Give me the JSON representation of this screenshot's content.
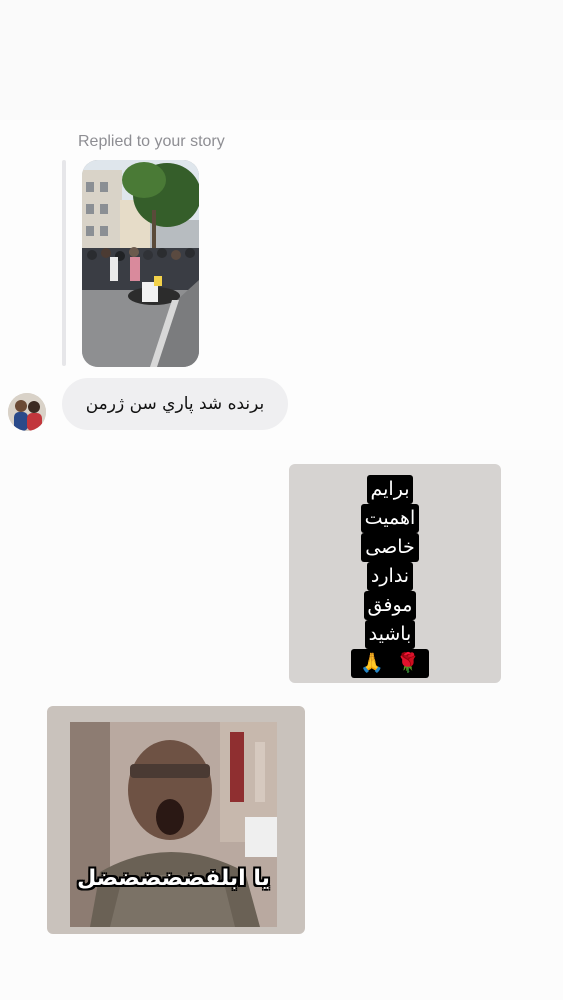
{
  "conversation": {
    "reply_context": {
      "label": "Replied to your story"
    },
    "incoming_message": {
      "text": "برنده شد پاري سن ژرمن"
    },
    "sticker_message_1": {
      "lines": [
        "برايم",
        "اهميت",
        "خاصی",
        "ندارد",
        "موفق",
        "باشيد"
      ],
      "emojis": [
        "🙏",
        "🌹"
      ]
    },
    "sticker_message_2": {
      "caption": "يا ابلفضضضضضل"
    }
  },
  "icons": {
    "story_thumbnail": "street-crowd-photo",
    "avatar": "user-avatar-photo"
  }
}
